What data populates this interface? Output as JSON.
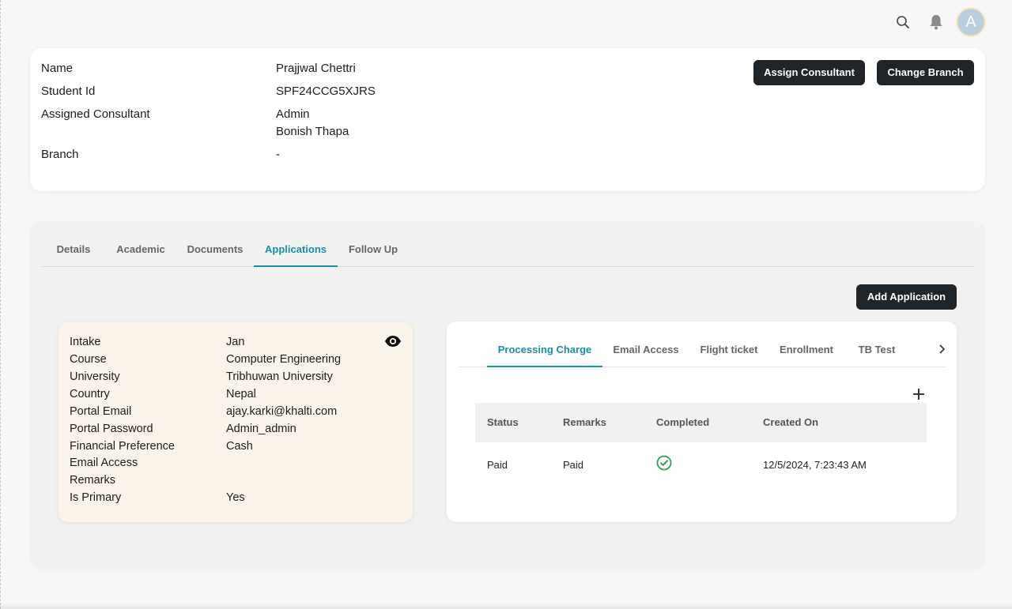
{
  "header": {
    "avatar_initial": "A",
    "icons": [
      "search-icon",
      "bell-icon"
    ]
  },
  "student": {
    "fields": [
      {
        "label": "Name",
        "value": "Prajjwal Chettri"
      },
      {
        "label": "Student Id",
        "value": "SPF24CCG5XJRS"
      },
      {
        "label": "Assigned Consultant",
        "value": "Admin",
        "value2": "Bonish Thapa"
      },
      {
        "label": "Branch",
        "value": "-"
      }
    ],
    "assign_consultant_label": "Assign Consultant",
    "change_branch_label": "Change Branch"
  },
  "tabs": {
    "items": [
      "Details",
      "Academic",
      "Documents",
      "Applications",
      "Follow Up"
    ],
    "active": "Applications"
  },
  "applications": {
    "add_label": "Add Application",
    "card": {
      "rows": [
        {
          "label": "Intake",
          "value": "Jan"
        },
        {
          "label": "Course",
          "value": "Computer Engineering"
        },
        {
          "label": "University",
          "value": "Tribhuwan University"
        },
        {
          "label": "Country",
          "value": "Nepal"
        },
        {
          "label": "Portal Email",
          "value": "ajay.karki@khalti.com"
        },
        {
          "label": "Portal Password",
          "value": "Admin_admin"
        },
        {
          "label": "Financial Preference",
          "value": "Cash"
        },
        {
          "label": "Email Access",
          "value": ""
        },
        {
          "label": "Remarks",
          "value": ""
        },
        {
          "label": "Is Primary",
          "value": "Yes"
        }
      ]
    },
    "subtabs": {
      "items": [
        "Processing Charge",
        "Email Access",
        "Flight ticket",
        "Enrollment",
        "TB Test"
      ],
      "active": "Processing Charge"
    },
    "table": {
      "columns": [
        "Status",
        "Remarks",
        "Completed",
        "Created On"
      ],
      "rows": [
        {
          "status": "Paid",
          "remarks": "Paid",
          "completed": true,
          "created_on": "12/5/2024, 7:23:43 AM"
        }
      ]
    }
  },
  "colors": {
    "accent": "#1b8fa0",
    "dark_button": "#1f2429",
    "card_cream": "#faf3ea",
    "check_green": "#2e9e44"
  }
}
